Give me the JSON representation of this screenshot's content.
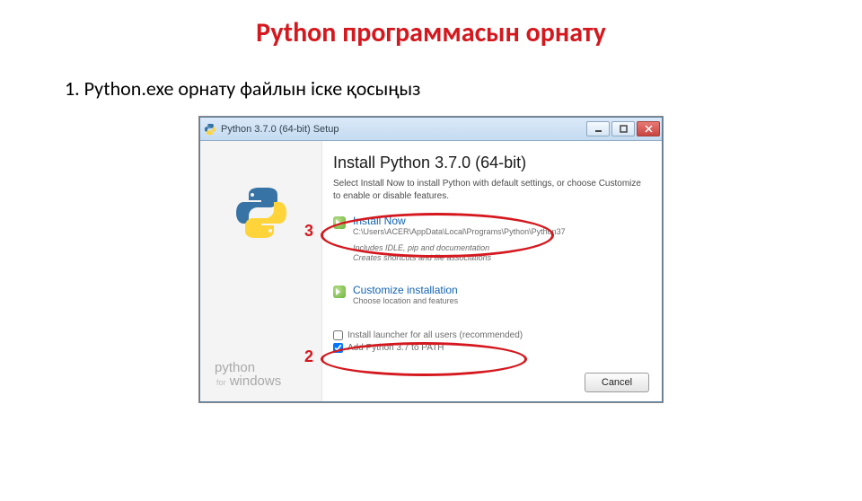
{
  "slide": {
    "title": "Python программасын орнату",
    "step1": "1.  Python.exe орнату файлын іске қосыңыз"
  },
  "window": {
    "title": "Python 3.7.0 (64-bit) Setup",
    "heading": "Install Python 3.7.0 (64-bit)",
    "intro": "Select Install Now to install Python with default settings, or choose Customize to enable or disable features.",
    "install_now": {
      "label": "Install Now",
      "path": "C:\\Users\\ACER\\AppData\\Local\\Programs\\Python\\Python37",
      "includes": "Includes IDLE, pip and documentation",
      "creates": "Creates shortcuts and file associations"
    },
    "customize": {
      "label": "Customize installation",
      "sub": "Choose location and features"
    },
    "check_launcher": "Install launcher for all users (recommended)",
    "check_path": "Add Python 3.7 to PATH",
    "cancel": "Cancel"
  },
  "sidebar": {
    "line1": "python",
    "for": "for",
    "line2": "windows"
  },
  "annotations": {
    "label3": "3",
    "label2": "2"
  }
}
